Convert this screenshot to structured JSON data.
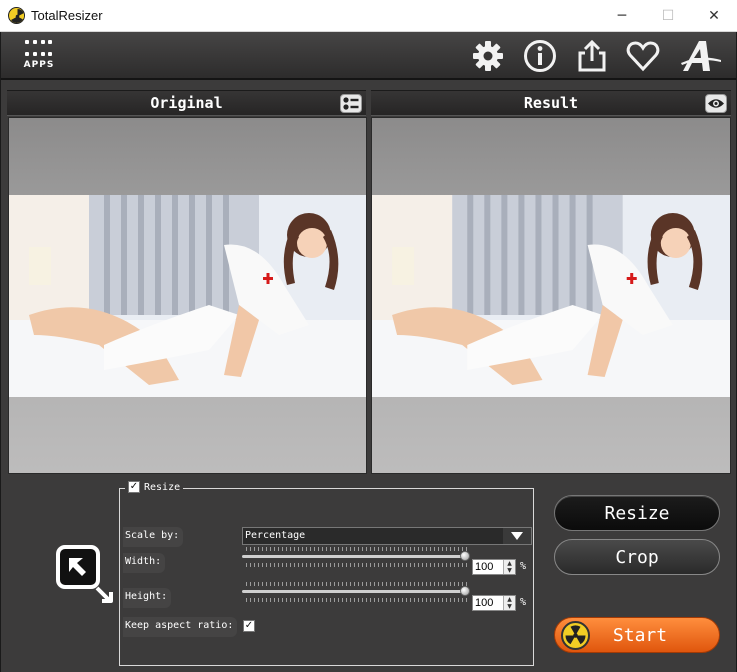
{
  "window": {
    "title": "TotalResizer",
    "minimize_glyph": "─",
    "maximize_glyph": "☐",
    "close_glyph": "✕"
  },
  "toolbar": {
    "apps_label": "APPS",
    "icons": [
      "settings-icon",
      "info-icon",
      "share-icon",
      "favorite-icon",
      "logo-icon"
    ]
  },
  "original": {
    "title": "Original",
    "header_button_icon": "layout-toggle-icon"
  },
  "result": {
    "title": "Result",
    "header_button_icon": "eye-icon"
  },
  "resize_group": {
    "label": "Resize",
    "checked": true,
    "scale_by_label": "Scale by:",
    "scale_by_value": "Percentage",
    "width_label": "Width:",
    "width_value": "100",
    "width_unit": "%",
    "height_label": "Height:",
    "height_value": "100",
    "height_unit": "%",
    "keep_aspect_label": "Keep aspect ratio:",
    "keep_aspect_checked": true
  },
  "buttons": {
    "resize": "Resize",
    "crop": "Crop",
    "start": "Start"
  },
  "colors": {
    "app_background": "#3c3b3b",
    "start_button": "#f07423",
    "radiation_yellow": "#f2cd24"
  }
}
